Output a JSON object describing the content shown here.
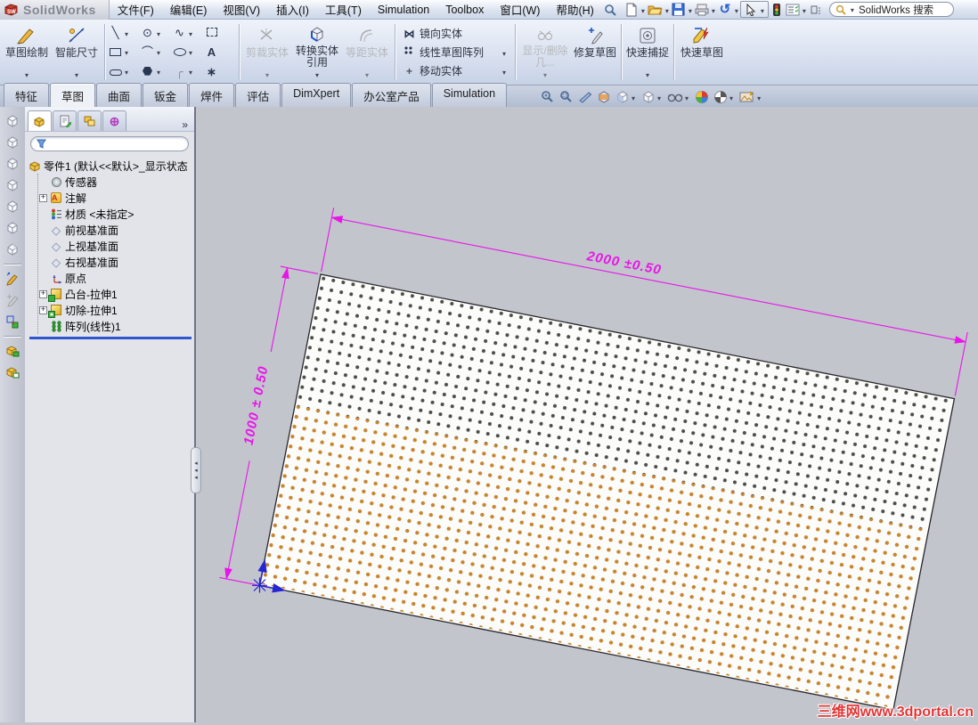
{
  "app": {
    "name": "SolidWorks",
    "search_text": "SolidWorks 搜索"
  },
  "menu": {
    "items": [
      "文件(F)",
      "编辑(E)",
      "视图(V)",
      "插入(I)",
      "工具(T)",
      "Simulation",
      "Toolbox",
      "窗口(W)",
      "帮助(H)"
    ]
  },
  "command_manager": {
    "sketch": "草图绘制",
    "smart_dimension": "智能尺寸",
    "trim": "剪裁实体",
    "convert": "转换实体引用",
    "offset": "等距实体",
    "mirror": "镜向实体",
    "linear_pattern": "线性草图阵列",
    "move": "移动实体",
    "display_delete": "显示/删除几...",
    "repair": "修复草图",
    "quick_snap": "快速捕捉",
    "rapid_sketch": "快速草图"
  },
  "ribbon_tabs": {
    "items": [
      "特征",
      "草图",
      "曲面",
      "钣金",
      "焊件",
      "评估",
      "DimXpert",
      "办公室产品",
      "Simulation"
    ],
    "active": "草图"
  },
  "feature_panel": {
    "root": "零件1 (默认<<默认>_显示状态",
    "items": [
      "传感器",
      "注解",
      "材质 <未指定>",
      "前视基准面",
      "上视基准面",
      "右视基准面",
      "原点",
      "凸台-拉伸1",
      "切除-拉伸1",
      "阵列(线性)1"
    ]
  },
  "viewport": {
    "dim_width": "2000  ±0.50",
    "dim_height": "1000  ± 0.50",
    "watermark": "三维网www.3dportal.cn"
  },
  "icons": {
    "chevron": "»",
    "line": "╲",
    "circle": "⊙",
    "spline": "∿",
    "arc": "⌒",
    "text_tool": "A",
    "point": "∗",
    "fillet": "╭",
    "undo": "↺",
    "mirror": "⋈",
    "plane": "◇",
    "circle_plus": "⊕"
  },
  "colors": {
    "dimension_magenta": "#e815e8",
    "hole_dark": "#4e4e48",
    "hole_orange": "#c8842d",
    "origin_blue": "#2525d2",
    "viewport_bg": "#c3c5cd",
    "watermark_red": "#e23535"
  }
}
